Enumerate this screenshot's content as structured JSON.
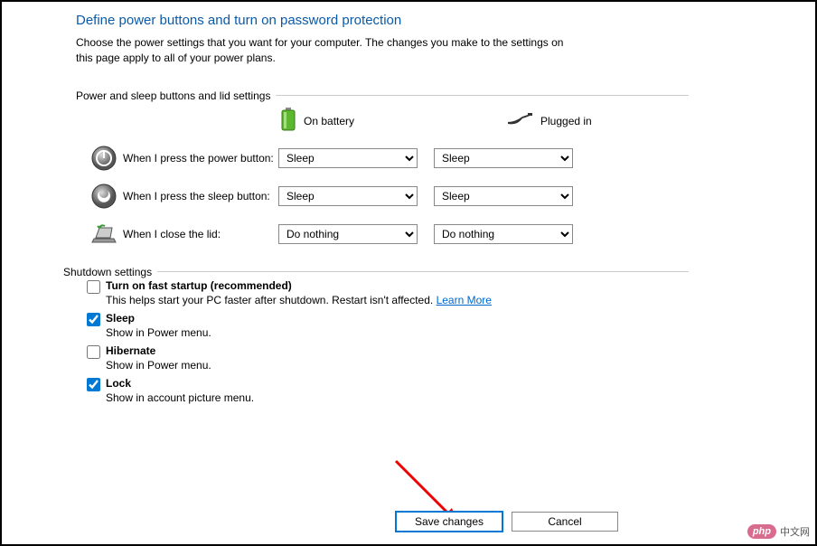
{
  "header": {
    "title": "Define power buttons and turn on password protection",
    "description": "Choose the power settings that you want for your computer. The changes you make to the settings on this page apply to all of your power plans."
  },
  "power_sleep": {
    "legend": "Power and sleep buttons and lid settings",
    "col_battery": "On battery",
    "col_plugged": "Plugged in",
    "rows": [
      {
        "label": "When I press the power button:",
        "battery": "Sleep",
        "plugged": "Sleep"
      },
      {
        "label": "When I press the sleep button:",
        "battery": "Sleep",
        "plugged": "Sleep"
      },
      {
        "label": "When I close the lid:",
        "battery": "Do nothing",
        "plugged": "Do nothing"
      }
    ]
  },
  "shutdown": {
    "legend": "Shutdown settings",
    "items": [
      {
        "checked": false,
        "title": "Turn on fast startup (recommended)",
        "sub": "This helps start your PC faster after shutdown. Restart isn't affected. ",
        "link": "Learn More"
      },
      {
        "checked": true,
        "title": "Sleep",
        "sub": "Show in Power menu."
      },
      {
        "checked": false,
        "title": "Hibernate",
        "sub": "Show in Power menu."
      },
      {
        "checked": true,
        "title": "Lock",
        "sub": "Show in account picture menu."
      }
    ]
  },
  "footer": {
    "save": "Save changes",
    "cancel": "Cancel"
  },
  "watermark": {
    "logo": "php",
    "text": "中文网"
  }
}
